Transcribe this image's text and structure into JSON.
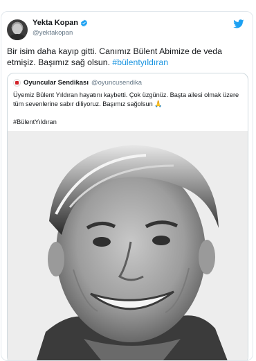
{
  "tweet": {
    "author_name": "Yekta Kopan",
    "author_handle": "@yektakopan",
    "text_main": "Bir isim daha kayıp gitti. Canımız Bülent Abimize de veda etmişiz. Başımız sağ olsun. ",
    "hashtag": "#bülentyıldıran"
  },
  "quoted": {
    "name": "Oyuncular Sendikası",
    "handle": "@oyuncusendika",
    "text": "Üyemiz Bülent Yıldıran hayatını kaybetti. Çok üzgünüz. Başta ailesi olmak üzere tüm sevenlerine sabır diliyoruz. Başımız sağolsun 🙏",
    "hashtag": "#BülentYıldıran"
  },
  "icons": {
    "verified": "verified-badge-icon",
    "bird": "twitter-bird-icon"
  },
  "colors": {
    "link": "#1b95e0",
    "verified": "#1da1f2",
    "text": "#14171a",
    "muted": "#657786"
  }
}
